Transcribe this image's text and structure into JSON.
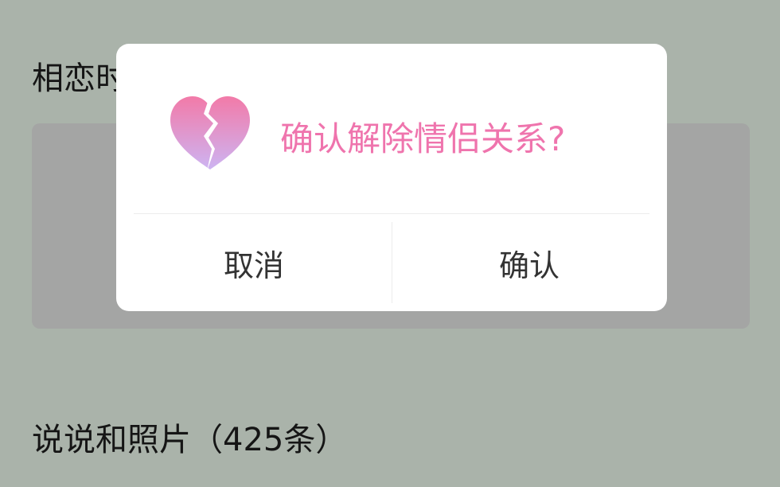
{
  "background": {
    "love_days_label": "相恋时",
    "posts_label": "说说和照片（425条）"
  },
  "dialog": {
    "icon": "broken-heart-icon",
    "title": "确认解除情侣关系?",
    "cancel_label": "取消",
    "confirm_label": "确认"
  },
  "colors": {
    "title": "#ef74ad",
    "heart_top": "#f27aa8",
    "heart_bottom": "#cdb4f2",
    "overlay_bg": "#aab3aa"
  }
}
